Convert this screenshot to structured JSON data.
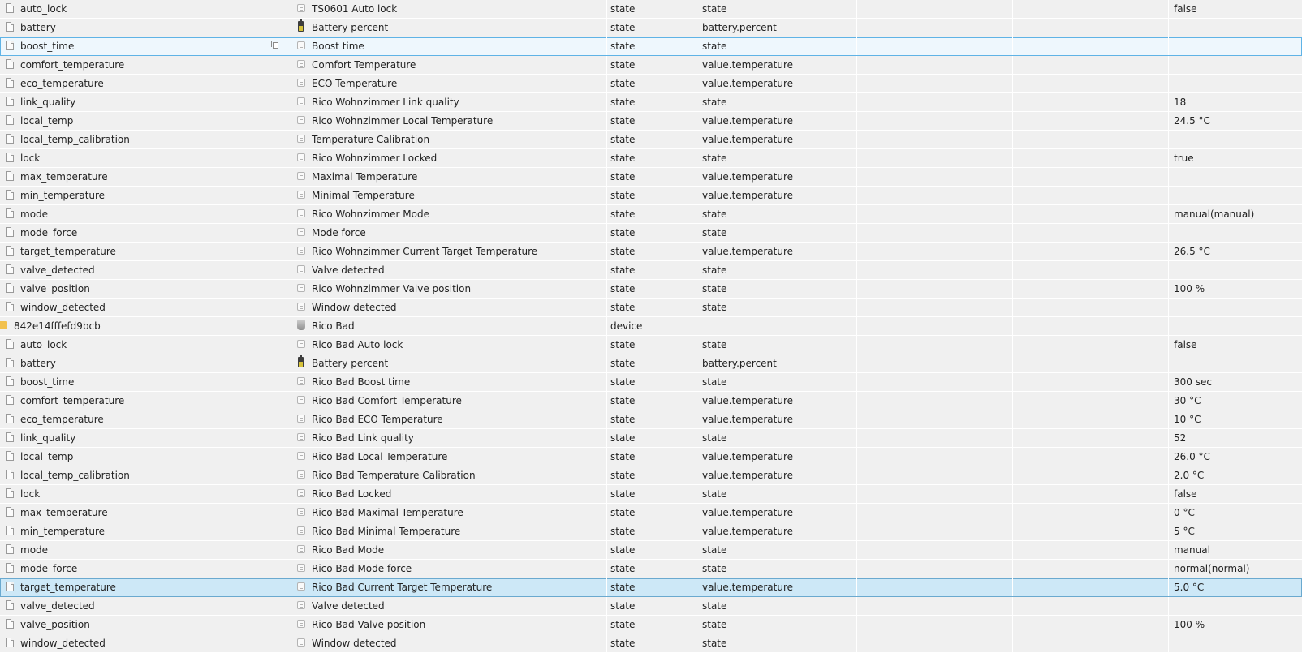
{
  "rows": [
    {
      "id": "auto_lock",
      "kind": "state",
      "name": "TS0601 Auto lock",
      "name_icon": "state-icon",
      "type": "state",
      "role": "state",
      "value": "false"
    },
    {
      "id": "battery",
      "kind": "state",
      "name": "Battery percent",
      "name_icon": "battery-icon",
      "type": "state",
      "role": "battery.percent",
      "value": ""
    },
    {
      "id": "boost_time",
      "kind": "state",
      "name": "Boost time",
      "name_icon": "state-icon",
      "type": "state",
      "role": "state",
      "value": "",
      "highlight": "hover"
    },
    {
      "id": "comfort_temperature",
      "kind": "state",
      "name": "Comfort Temperature",
      "name_icon": "state-icon",
      "type": "state",
      "role": "value.temperature",
      "value": ""
    },
    {
      "id": "eco_temperature",
      "kind": "state",
      "name": "ECO Temperature",
      "name_icon": "state-icon",
      "type": "state",
      "role": "value.temperature",
      "value": ""
    },
    {
      "id": "link_quality",
      "kind": "state",
      "name": "Rico Wohnzimmer Link quality",
      "name_icon": "state-icon",
      "type": "state",
      "role": "state",
      "value": "18"
    },
    {
      "id": "local_temp",
      "kind": "state",
      "name": "Rico Wohnzimmer Local Temperature",
      "name_icon": "state-icon",
      "type": "state",
      "role": "value.temperature",
      "value": "24.5 °C"
    },
    {
      "id": "local_temp_calibration",
      "kind": "state",
      "name": "Temperature Calibration",
      "name_icon": "state-icon",
      "type": "state",
      "role": "value.temperature",
      "value": ""
    },
    {
      "id": "lock",
      "kind": "state",
      "name": "Rico Wohnzimmer Locked",
      "name_icon": "state-icon",
      "type": "state",
      "role": "state",
      "value": "true"
    },
    {
      "id": "max_temperature",
      "kind": "state",
      "name": "Maximal Temperature",
      "name_icon": "state-icon",
      "type": "state",
      "role": "value.temperature",
      "value": ""
    },
    {
      "id": "min_temperature",
      "kind": "state",
      "name": "Minimal Temperature",
      "name_icon": "state-icon",
      "type": "state",
      "role": "value.temperature",
      "value": ""
    },
    {
      "id": "mode",
      "kind": "state",
      "name": "Rico Wohnzimmer Mode",
      "name_icon": "state-icon",
      "type": "state",
      "role": "state",
      "value": "manual(manual)"
    },
    {
      "id": "mode_force",
      "kind": "state",
      "name": "Mode force",
      "name_icon": "state-icon",
      "type": "state",
      "role": "state",
      "value": ""
    },
    {
      "id": "target_temperature",
      "kind": "state",
      "name": "Rico Wohnzimmer Current Target Temperature",
      "name_icon": "state-icon",
      "type": "state",
      "role": "value.temperature",
      "value": "26.5 °C"
    },
    {
      "id": "valve_detected",
      "kind": "state",
      "name": "Valve detected",
      "name_icon": "state-icon",
      "type": "state",
      "role": "state",
      "value": ""
    },
    {
      "id": "valve_position",
      "kind": "state",
      "name": "Rico Wohnzimmer Valve position",
      "name_icon": "state-icon",
      "type": "state",
      "role": "state",
      "value": "100 %"
    },
    {
      "id": "window_detected",
      "kind": "state",
      "name": "Window detected",
      "name_icon": "state-icon",
      "type": "state",
      "role": "state",
      "value": ""
    },
    {
      "id": "842e14fffefd9bcb",
      "kind": "device",
      "name": "Rico Bad",
      "name_icon": "device-icon",
      "type": "device",
      "role": "",
      "value": ""
    },
    {
      "id": "auto_lock",
      "kind": "state",
      "name": "Rico Bad Auto lock",
      "name_icon": "state-icon",
      "type": "state",
      "role": "state",
      "value": "false"
    },
    {
      "id": "battery",
      "kind": "state",
      "name": "Battery percent",
      "name_icon": "battery-icon",
      "type": "state",
      "role": "battery.percent",
      "value": ""
    },
    {
      "id": "boost_time",
      "kind": "state",
      "name": "Rico Bad Boost time",
      "name_icon": "state-icon",
      "type": "state",
      "role": "state",
      "value": "300 sec"
    },
    {
      "id": "comfort_temperature",
      "kind": "state",
      "name": "Rico Bad Comfort Temperature",
      "name_icon": "state-icon",
      "type": "state",
      "role": "value.temperature",
      "value": "30 °C"
    },
    {
      "id": "eco_temperature",
      "kind": "state",
      "name": "Rico Bad ECO Temperature",
      "name_icon": "state-icon",
      "type": "state",
      "role": "value.temperature",
      "value": "10 °C"
    },
    {
      "id": "link_quality",
      "kind": "state",
      "name": "Rico Bad Link quality",
      "name_icon": "state-icon",
      "type": "state",
      "role": "state",
      "value": "52"
    },
    {
      "id": "local_temp",
      "kind": "state",
      "name": "Rico Bad Local Temperature",
      "name_icon": "state-icon",
      "type": "state",
      "role": "value.temperature",
      "value": "26.0 °C"
    },
    {
      "id": "local_temp_calibration",
      "kind": "state",
      "name": "Rico Bad Temperature Calibration",
      "name_icon": "state-icon",
      "type": "state",
      "role": "value.temperature",
      "value": "2.0 °C"
    },
    {
      "id": "lock",
      "kind": "state",
      "name": "Rico Bad Locked",
      "name_icon": "state-icon",
      "type": "state",
      "role": "state",
      "value": "false"
    },
    {
      "id": "max_temperature",
      "kind": "state",
      "name": "Rico Bad Maximal Temperature",
      "name_icon": "state-icon",
      "type": "state",
      "role": "value.temperature",
      "value": "0 °C"
    },
    {
      "id": "min_temperature",
      "kind": "state",
      "name": "Rico Bad Minimal Temperature",
      "name_icon": "state-icon",
      "type": "state",
      "role": "value.temperature",
      "value": "5 °C"
    },
    {
      "id": "mode",
      "kind": "state",
      "name": "Rico Bad Mode",
      "name_icon": "state-icon",
      "type": "state",
      "role": "state",
      "value": "manual"
    },
    {
      "id": "mode_force",
      "kind": "state",
      "name": "Rico Bad Mode force",
      "name_icon": "state-icon",
      "type": "state",
      "role": "state",
      "value": "normal(normal)"
    },
    {
      "id": "target_temperature",
      "kind": "state",
      "name": "Rico Bad Current Target Temperature",
      "name_icon": "state-icon",
      "type": "state",
      "role": "value.temperature",
      "value": "5.0 °C",
      "highlight": "selected"
    },
    {
      "id": "valve_detected",
      "kind": "state",
      "name": "Valve detected",
      "name_icon": "state-icon",
      "type": "state",
      "role": "state",
      "value": ""
    },
    {
      "id": "valve_position",
      "kind": "state",
      "name": "Rico Bad Valve position",
      "name_icon": "state-icon",
      "type": "state",
      "role": "state",
      "value": "100 %"
    },
    {
      "id": "window_detected",
      "kind": "state",
      "name": "Window detected",
      "name_icon": "state-icon",
      "type": "state",
      "role": "state",
      "value": ""
    }
  ],
  "hover_row_icon": "copy-icon"
}
